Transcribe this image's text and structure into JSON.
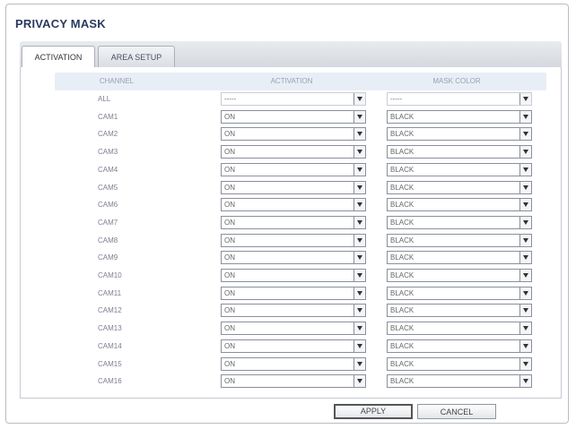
{
  "dialog": {
    "title": "PRIVACY MASK",
    "tabs": [
      {
        "label": "ACTIVATION",
        "active": true
      },
      {
        "label": "AREA SETUP",
        "active": false
      }
    ]
  },
  "table": {
    "headers": {
      "channel": "CHANNEL",
      "activation": "ACTIVATION",
      "mask_color": "MASK COLOR"
    },
    "all_row": {
      "channel": "ALL",
      "activation": "-----",
      "mask_color": "-----"
    },
    "rows": [
      {
        "channel": "CAM1",
        "activation": "ON",
        "mask_color": "BLACK"
      },
      {
        "channel": "CAM2",
        "activation": "ON",
        "mask_color": "BLACK"
      },
      {
        "channel": "CAM3",
        "activation": "ON",
        "mask_color": "BLACK"
      },
      {
        "channel": "CAM4",
        "activation": "ON",
        "mask_color": "BLACK"
      },
      {
        "channel": "CAM5",
        "activation": "ON",
        "mask_color": "BLACK"
      },
      {
        "channel": "CAM6",
        "activation": "ON",
        "mask_color": "BLACK"
      },
      {
        "channel": "CAM7",
        "activation": "ON",
        "mask_color": "BLACK"
      },
      {
        "channel": "CAM8",
        "activation": "ON",
        "mask_color": "BLACK"
      },
      {
        "channel": "CAM9",
        "activation": "ON",
        "mask_color": "BLACK"
      },
      {
        "channel": "CAM10",
        "activation": "ON",
        "mask_color": "BLACK"
      },
      {
        "channel": "CAM11",
        "activation": "ON",
        "mask_color": "BLACK"
      },
      {
        "channel": "CAM12",
        "activation": "ON",
        "mask_color": "BLACK"
      },
      {
        "channel": "CAM13",
        "activation": "ON",
        "mask_color": "BLACK"
      },
      {
        "channel": "CAM14",
        "activation": "ON",
        "mask_color": "BLACK"
      },
      {
        "channel": "CAM15",
        "activation": "ON",
        "mask_color": "BLACK"
      },
      {
        "channel": "CAM16",
        "activation": "ON",
        "mask_color": "BLACK"
      }
    ]
  },
  "buttons": {
    "apply": "APPLY",
    "cancel": "CANCEL"
  },
  "icons": {
    "dropdown": "chevron-down-icon"
  },
  "colors": {
    "title": "#2a3a5f",
    "header_bg": "#e8eef6",
    "border": "#8a8f9a"
  }
}
